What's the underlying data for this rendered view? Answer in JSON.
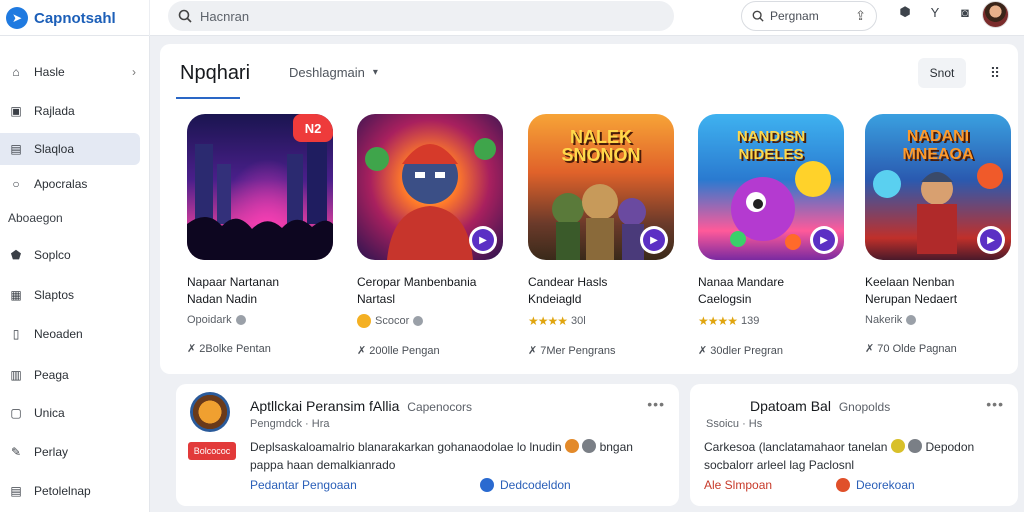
{
  "header": {
    "brand_name": "Capnotsahl",
    "search_placeholder": "Hacnran",
    "pill_label": "Pergnam",
    "icons": [
      "search-icon",
      "share-icon",
      "shield-icon",
      "chevron-icon",
      "camera-icon"
    ]
  },
  "sidebar": {
    "items": [
      {
        "label": "Hasle",
        "icon": "home-icon"
      },
      {
        "label": "Rajlada",
        "icon": "bag-icon"
      },
      {
        "label": "Slaqloa",
        "icon": "folder-icon"
      },
      {
        "label": "Apocralas",
        "icon": "chat-icon"
      },
      {
        "label": "Soplco",
        "icon": "shield-icon"
      },
      {
        "label": "Slaptos",
        "icon": "grid-icon"
      },
      {
        "label": "Neoaden",
        "icon": "book-icon"
      },
      {
        "label": "Peaga",
        "icon": "calendar-icon"
      },
      {
        "label": "Unica",
        "icon": "window-icon"
      },
      {
        "label": "Perlay",
        "icon": "pin-icon"
      },
      {
        "label": "Petolelnap",
        "icon": "doc-icon"
      }
    ],
    "section_label": "Aboaegon"
  },
  "main": {
    "title": "Npqhari",
    "filter_label": "Deshlagmain",
    "sort_label": "Snot",
    "badge": "N2",
    "cards": [
      {
        "name_line1": "Napaar Nartanan",
        "name_line2": "Nadan Nadin",
        "rating_text": "Opoidark",
        "downloads": "✗ 2Bolke Pentan",
        "thumb_title": ""
      },
      {
        "name_line1": "Ceropar Manbenbania",
        "name_line2": "Nartasl",
        "rating_text": "Scocor",
        "downloads": "✗ 200lle Pengan",
        "thumb_title": ""
      },
      {
        "name_line1": "Candear Hasls",
        "name_line2": "Kndeiagld",
        "rating_text": "30l",
        "stars": "★★★★",
        "downloads": "✗ 7Mer Pengrans",
        "thumb_title": "NALEK SNONON"
      },
      {
        "name_line1": "Nanaa Mandare",
        "name_line2": "Caelogsin",
        "rating_text": "139",
        "stars": "★★★★",
        "downloads": "✗ 30dler Pregran",
        "thumb_title": "NANDISN NIDELES"
      },
      {
        "name_line1": "Keelaan Nenban",
        "name_line2": "Nerupan Nedaert",
        "rating_text": "Nakerik",
        "downloads": "✗ 70 Olde Pagnan",
        "thumb_title": "NADANI MNEAOA"
      }
    ]
  },
  "bottom": {
    "left": {
      "title": "Aptllckai Peransim fAllia",
      "publisher": "Capenocors",
      "meta": "Pengmdck · Hra",
      "desc_line1": "Deplsaskaloamalrio blanarakarkan gohanaodolae lo lnudin",
      "desc_line1_end": "bngan",
      "desc_line2": "pappa haan demalkianrado",
      "tag": "Bolcococ",
      "link1": "Pedantar Pengoaan",
      "link2": "Dedcodeldon"
    },
    "right": {
      "title": "Dpatoam Bal",
      "publisher": "Gnopolds",
      "meta": "Ssoicu · Hs",
      "desc_line1": "Carkesoa (lanclatamahaor tanelan",
      "desc_line1_end": "Depodon",
      "desc_line2": "socbalorr arleel lag Paclosnl",
      "tag": "Ale Slmpoan",
      "link": "Deorekoan"
    }
  },
  "colors": {
    "accent": "#2a67c6",
    "badge": "#ee3b3b",
    "play": "#5b2fc4",
    "star": "#e0a50f"
  }
}
